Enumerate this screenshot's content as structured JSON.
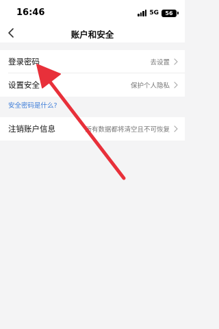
{
  "status_bar": {
    "time": "16:46",
    "network": "5G",
    "battery": "56"
  },
  "nav": {
    "title": "账户和安全",
    "back_icon": "chevron-left-icon"
  },
  "rows": [
    {
      "label": "登录密码",
      "value": "去设置"
    },
    {
      "label": "设置安全",
      "value": "保护个人隐私"
    },
    {
      "label": "注销账户信息",
      "value": "所有数据都将清空且不可恢复"
    }
  ],
  "help_link": "安全密码是什么?",
  "annotation": {
    "color": "#e8303a",
    "icon": "red-arrow"
  }
}
